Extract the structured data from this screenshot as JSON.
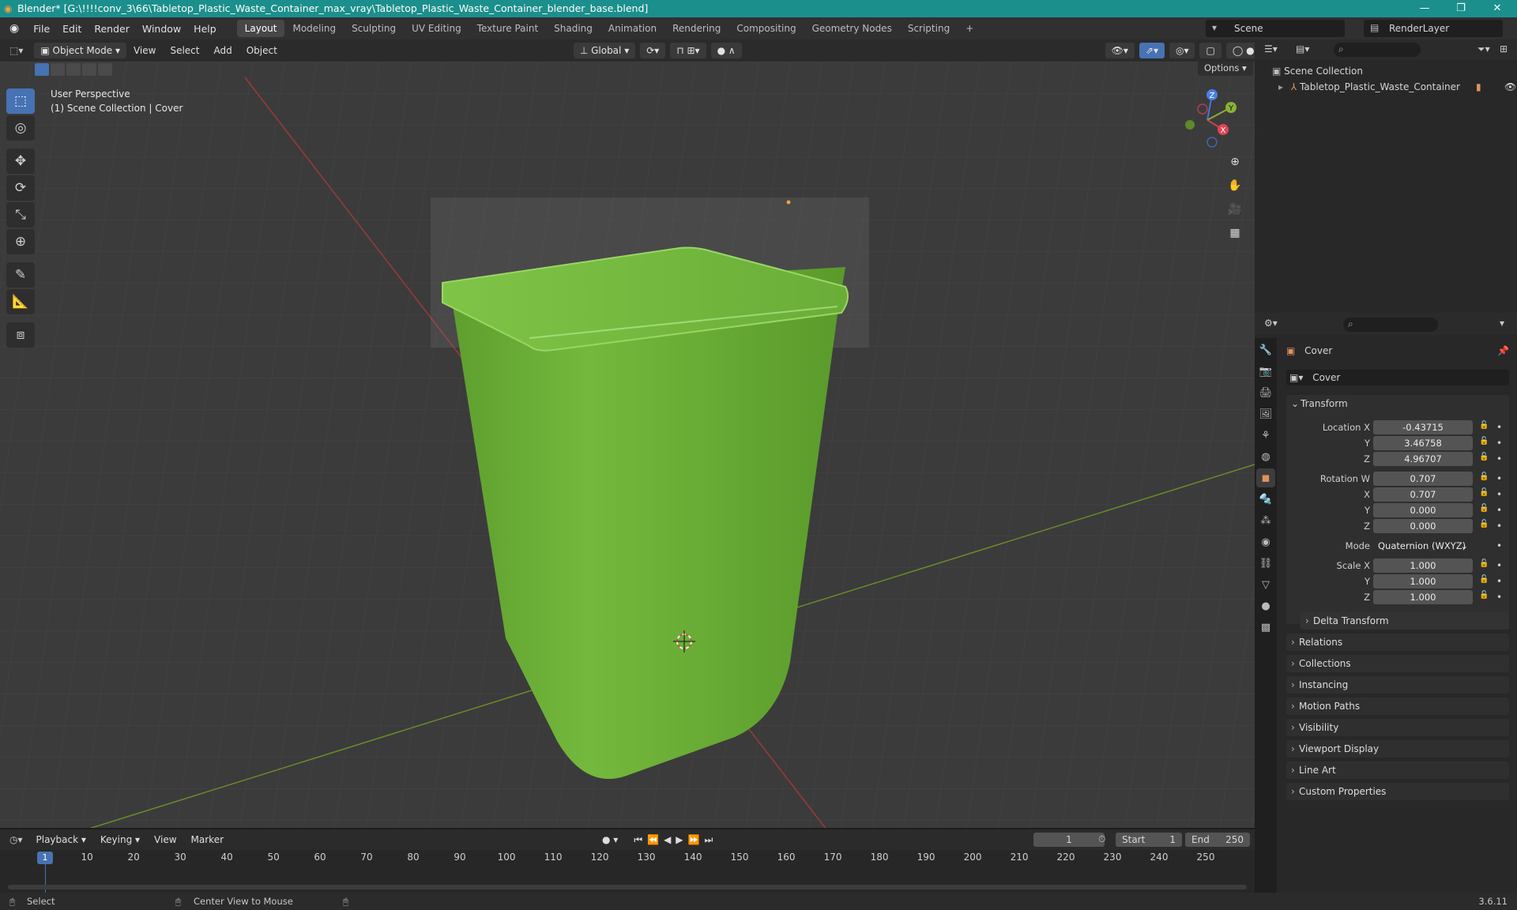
{
  "window": {
    "title": "Blender* [G:\\!!!!conv_3\\66\\Tabletop_Plastic_Waste_Container_max_vray\\Tabletop_Plastic_Waste_Container_blender_base.blend]"
  },
  "menus": [
    "File",
    "Edit",
    "Render",
    "Window",
    "Help"
  ],
  "workspaces": [
    "Layout",
    "Modeling",
    "Sculpting",
    "UV Editing",
    "Texture Paint",
    "Shading",
    "Animation",
    "Rendering",
    "Compositing",
    "Geometry Nodes",
    "Scripting"
  ],
  "scene": {
    "name": "Scene",
    "render_layer": "RenderLayer"
  },
  "viewport": {
    "mode": "Object Mode",
    "menus": [
      "View",
      "Select",
      "Add",
      "Object"
    ],
    "orientation": "Global",
    "options": "Options",
    "info_line1": "User Perspective",
    "info_line2": "(1) Scene Collection | Cover",
    "gizmo": {
      "x": "X",
      "y": "Y",
      "z": "Z"
    }
  },
  "outliner": {
    "root": "Scene Collection",
    "item": "Tabletop_Plastic_Waste_Container"
  },
  "properties": {
    "object_name": "Cover",
    "data_name": "Cover",
    "transform_label": "Transform",
    "location_label": "Location X",
    "y_label": "Y",
    "z_label": "Z",
    "x_label": "X",
    "location": {
      "x": "-0.43715",
      "y": "3.46758",
      "z": "4.96707"
    },
    "rotation_label": "Rotation W",
    "rotation": {
      "w": "0.707",
      "x": "0.707",
      "y": "0.000",
      "z": "0.000"
    },
    "mode_label": "Mode",
    "mode_value": "Quaternion (WXYZ)",
    "scale_label": "Scale X",
    "scale": {
      "x": "1.000",
      "y": "1.000",
      "z": "1.000"
    },
    "delta_transform": "Delta Transform",
    "panels": [
      "Relations",
      "Collections",
      "Instancing",
      "Motion Paths",
      "Visibility",
      "Viewport Display",
      "Line Art",
      "Custom Properties"
    ]
  },
  "timeline": {
    "menus": [
      "Playback",
      "Keying",
      "View",
      "Marker"
    ],
    "current_frame": "1",
    "start_label": "Start",
    "start": "1",
    "end_label": "End",
    "end": "250",
    "ticks": [
      "10",
      "20",
      "30",
      "40",
      "50",
      "60",
      "70",
      "80",
      "90",
      "100",
      "110",
      "120",
      "130",
      "140",
      "150",
      "160",
      "170",
      "180",
      "190",
      "200",
      "210",
      "220",
      "230",
      "240",
      "250"
    ],
    "playhead": "1"
  },
  "status": {
    "select": "Select",
    "center": "Center View to Mouse",
    "version": "3.6.11"
  },
  "colors": {
    "accent": "#4772b3",
    "title_bar": "#1b8f8c",
    "object": "#6fb43a"
  }
}
